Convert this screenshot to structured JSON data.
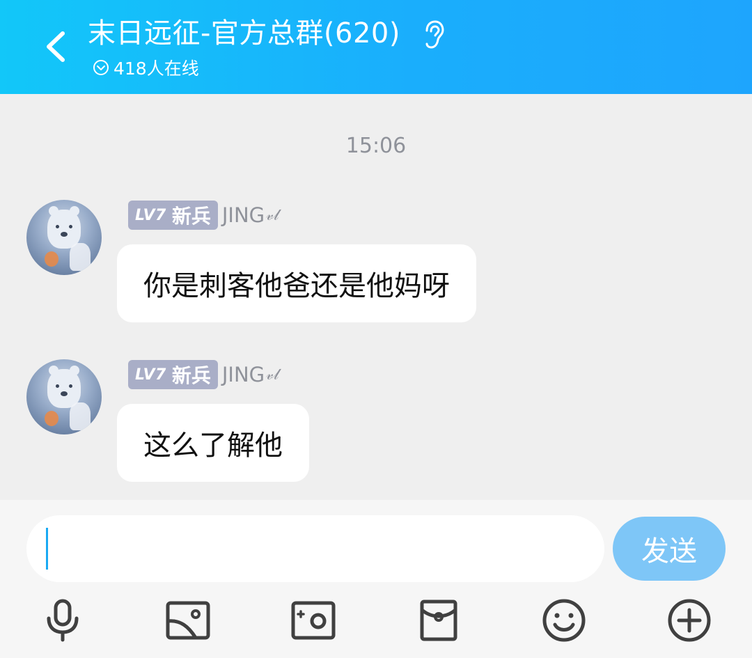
{
  "header": {
    "title": "末日远征-官方总群(620)",
    "online_text": "418人在线",
    "back_icon": "chevron-left-icon",
    "ear_icon": "ear-icon"
  },
  "chat": {
    "timestamp": "15:06",
    "messages": [
      {
        "level": "LV7",
        "rank": "新兵",
        "nickname": "JING",
        "nickname_suffix": "𝓋𝓁",
        "text": "你是刺客他爸还是他妈呀"
      },
      {
        "level": "LV7",
        "rank": "新兵",
        "nickname": "JING",
        "nickname_suffix": "𝓋𝓁",
        "text": "这么了解他"
      }
    ]
  },
  "composer": {
    "input_value": "",
    "send_label": "发送",
    "tools": [
      "microphone-icon",
      "image-icon",
      "camera-icon",
      "red-packet-icon",
      "emoji-icon",
      "plus-icon"
    ]
  },
  "colors": {
    "header_start": "#12c7f9",
    "header_end": "#1ea5fd",
    "send_button": "#7ec6f7",
    "badge": "#a9aec7",
    "background": "#efefef"
  }
}
